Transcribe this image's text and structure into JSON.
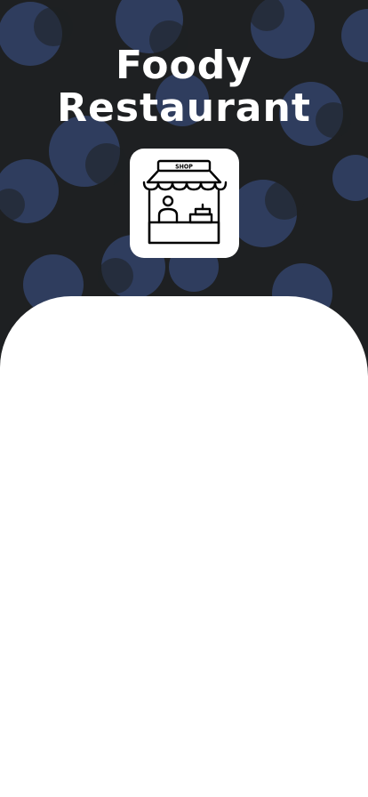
{
  "splash": {
    "title_line1": "Foody",
    "title_line2": "Restaurant",
    "logo": {
      "icon": "shop-stall-icon",
      "sign_text": "SHOP"
    }
  },
  "colors": {
    "background_dark": "#1e2022",
    "pattern_blue": "#2f3d5e",
    "panel": "#ffffff",
    "title": "#ffffff"
  }
}
